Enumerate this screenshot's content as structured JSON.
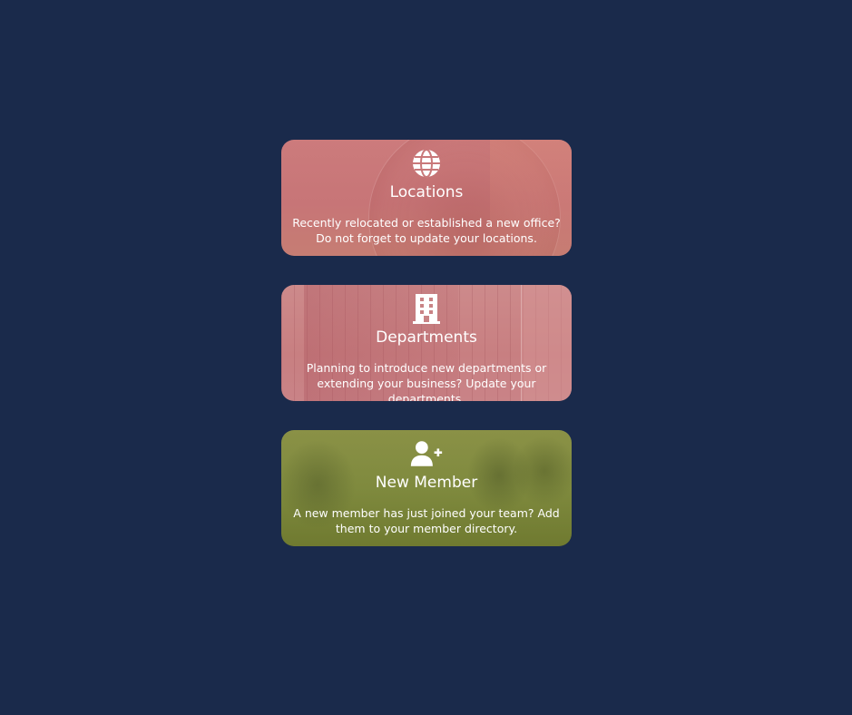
{
  "cards": [
    {
      "id": "locations",
      "icon": "globe-icon",
      "title": "Locations",
      "description": "Recently relocated or established a new office? Do not forget to update your locations.",
      "accent": "#c97879"
    },
    {
      "id": "departments",
      "icon": "building-icon",
      "title": "Departments",
      "description": "Planning to introduce new departments or extending your business? Update your departments.",
      "accent": "#cb8486"
    },
    {
      "id": "new-member",
      "icon": "add-user-icon",
      "title": "New Member",
      "description": "A new member has just joined your team? Add them to your member directory.",
      "accent": "#7f8a3e"
    }
  ],
  "colors": {
    "background": "#1a2a4b",
    "text": "#ffffff"
  }
}
